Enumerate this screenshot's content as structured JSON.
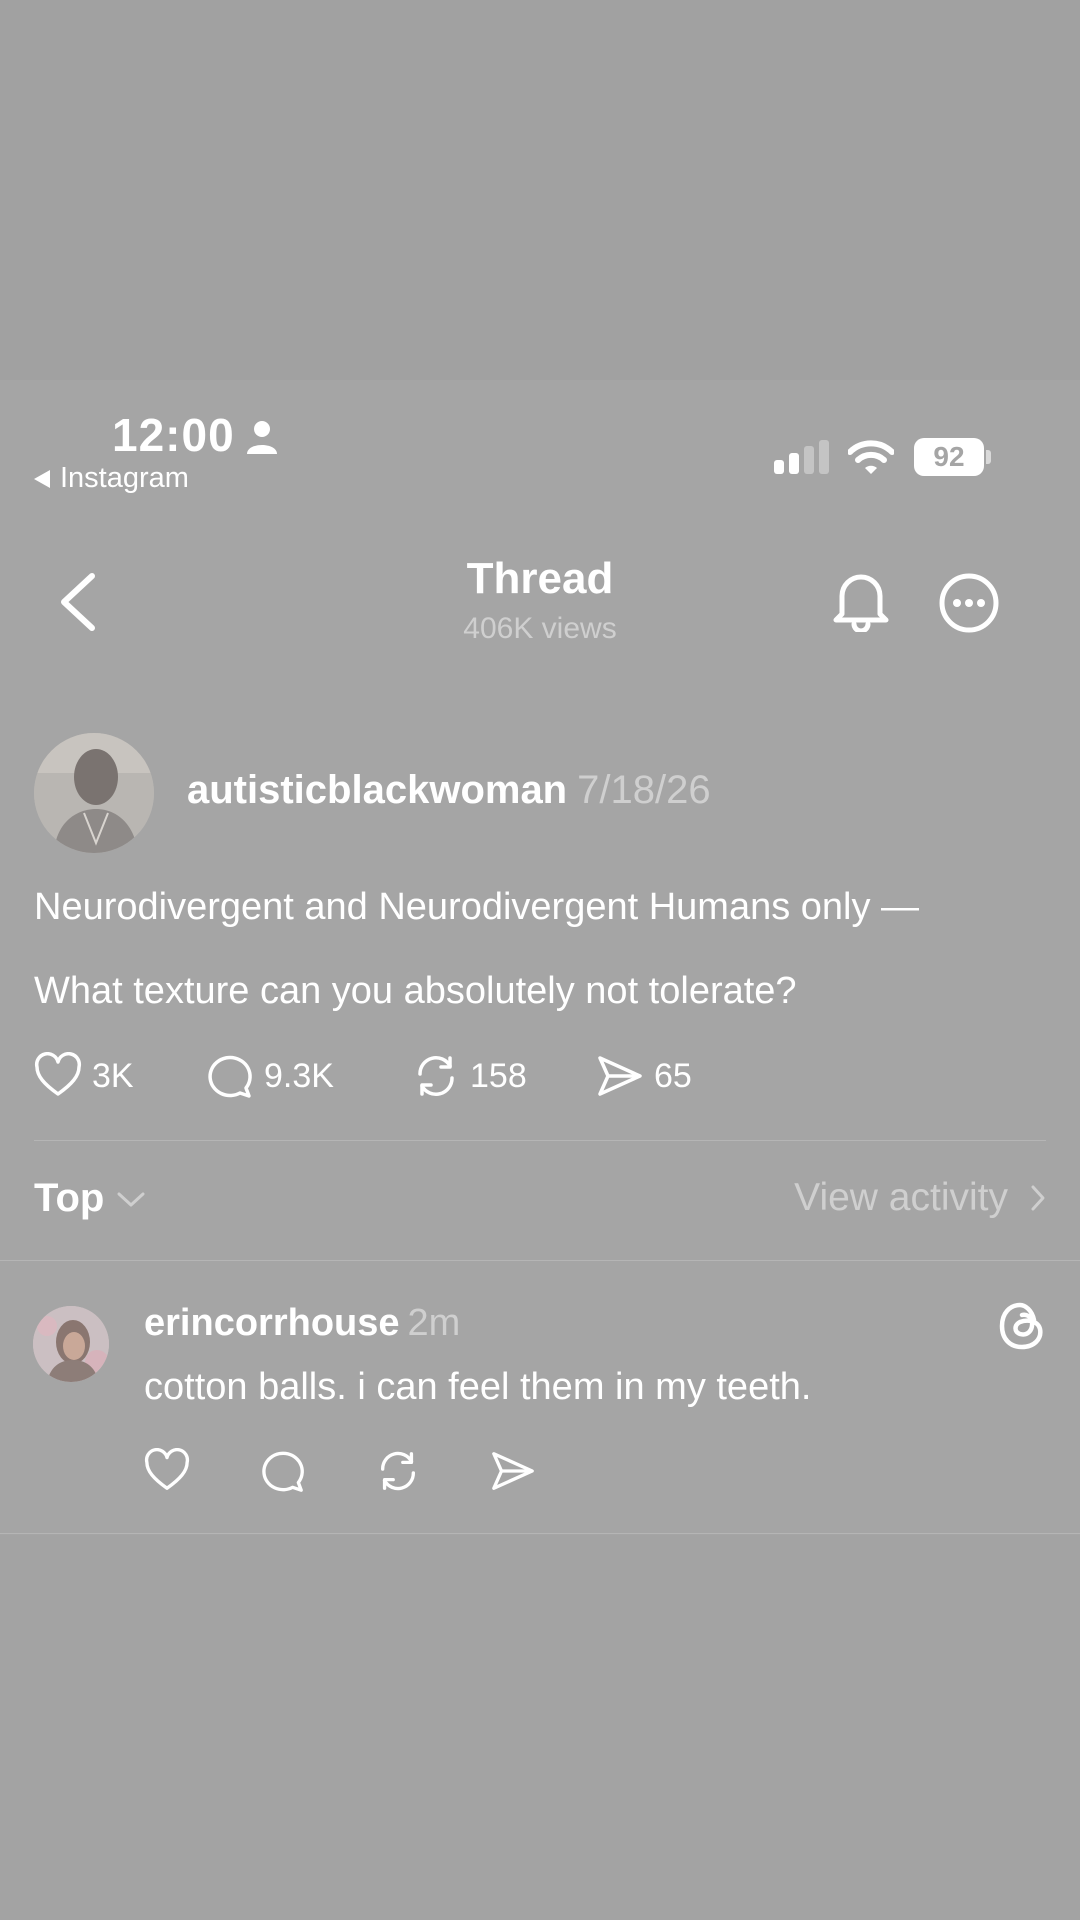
{
  "status_bar": {
    "time": "12:00",
    "back_app_label": "Instagram",
    "battery": "92"
  },
  "header": {
    "title": "Thread",
    "views": "406K views"
  },
  "post": {
    "username": "autisticblackwoman",
    "date": "7/18/26",
    "text_line1": "Neurodivergent and Neurodivergent Humans only —",
    "text_line2": "What texture can you absolutely not tolerate?",
    "likes": "3K",
    "comments": "9.3K",
    "reposts": "158",
    "shares": "65"
  },
  "sort": {
    "label": "Top",
    "view_activity": "View activity"
  },
  "reply": {
    "username": "erincorrhouse",
    "time": "2m",
    "text": "cotton balls. i can feel them in my teeth."
  },
  "colors": {
    "background": "#a5a5a5",
    "text": "#ffffff",
    "muted_text": "#cfcfcf"
  }
}
